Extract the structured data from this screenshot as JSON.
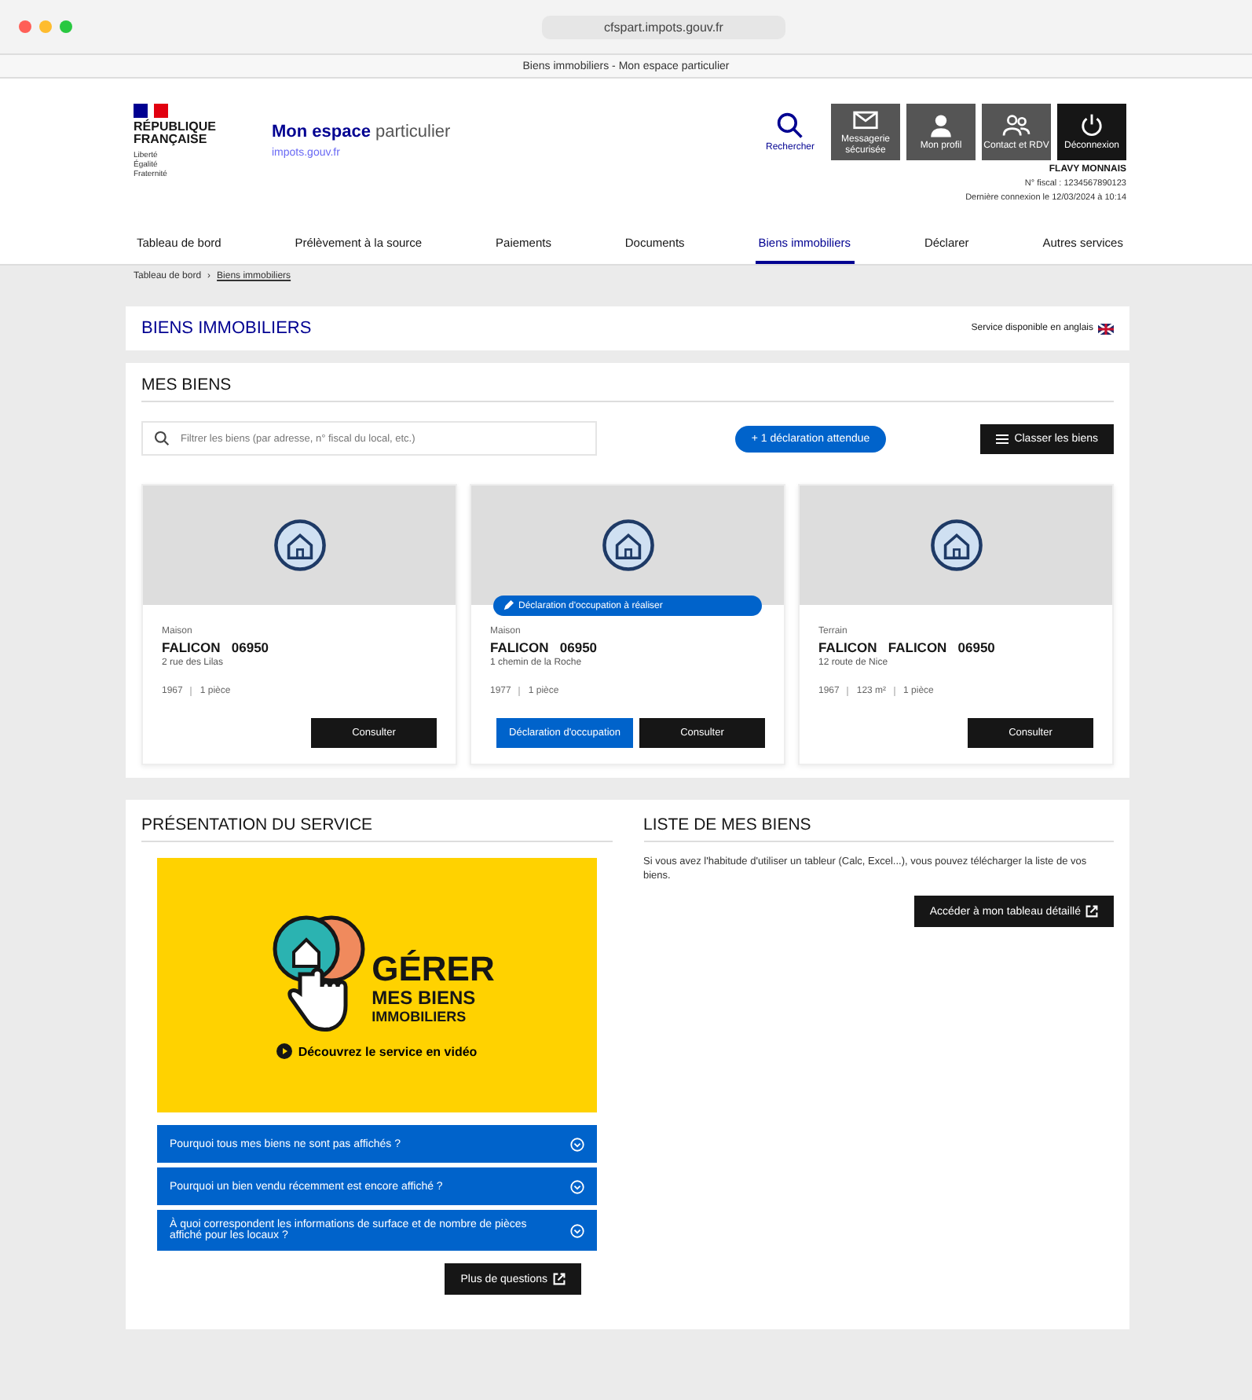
{
  "browser": {
    "url": "cfspart.impots.gouv.fr",
    "tab_title": "Biens immobiliers - Mon espace particulier"
  },
  "header": {
    "brand": "RÉPUBLIQUE FRANÇAISE",
    "motto": "Liberté Égalité Fraternité",
    "title_strong": "Mon espace",
    "title_light": "particulier",
    "subtitle": "impots.gouv.fr",
    "actions": [
      {
        "label": "Rechercher",
        "kind": "search"
      },
      {
        "label": "Messagerie sécurisée",
        "kind": "mail"
      },
      {
        "label": "Mon profil",
        "kind": "profile"
      },
      {
        "label": "Contact et RDV",
        "kind": "contact"
      },
      {
        "label": "Déconnexion",
        "kind": "power"
      }
    ],
    "user": {
      "name": "FLAVY MONNAIS",
      "fiscal_number": "N° fiscal : 1234567890123",
      "last_login": "Dernière connexion le 12/03/2024 à 10:14"
    }
  },
  "nav": [
    {
      "label": "Tableau de bord",
      "selected": false
    },
    {
      "label": "Prélèvement à la source",
      "selected": false
    },
    {
      "label": "Paiements",
      "selected": false
    },
    {
      "label": "Documents",
      "selected": false
    },
    {
      "label": "Biens immobiliers",
      "selected": true
    },
    {
      "label": "Déclarer",
      "selected": false
    },
    {
      "label": "Autres services",
      "selected": false
    }
  ],
  "breadcrumb": [
    "Tableau de bord",
    "Biens immobiliers"
  ],
  "breadcrumb_separator": "›",
  "page_title": "BIENS IMMOBILIERS",
  "language_note": "Service disponible en anglais",
  "properties": {
    "title": "MES BIENS",
    "search": {
      "placeholder": "Filtrer les biens (par adresse, n° fiscal du local, etc.)"
    },
    "pending_button": "+ 1 déclaration attendue",
    "sort_button": "Classer les biens",
    "cards": [
      {
        "type": "Maison",
        "city": "FALICON   06950",
        "address": "2 rue des Lilas",
        "details": [
          "1967",
          "1 pièce"
        ],
        "buttons": [
          {
            "label": "Consulter",
            "kind": "dark"
          }
        ]
      },
      {
        "type": "Maison",
        "city": "FALICON   06950",
        "address": "1 chemin de la Roche",
        "details": [
          "1977",
          "1 pièce"
        ],
        "badge": "Déclaration d'occupation à réaliser",
        "buttons": [
          {
            "label": "Déclaration d'occupation",
            "kind": "primary"
          },
          {
            "label": "Consulter",
            "kind": "dark"
          }
        ]
      },
      {
        "type": "Terrain",
        "city": "FALICON   FALICON   06950",
        "address": "12 route de Nice",
        "details": [
          "1967",
          "123 m²",
          "1 pièce"
        ],
        "buttons": [
          {
            "label": "Consulter",
            "kind": "dark"
          }
        ]
      }
    ]
  },
  "presentation": {
    "title": "PRÉSENTATION DU SERVICE",
    "banner_title": "GÉRER",
    "banner_subtitle": "MES BIENS",
    "banner_subtitle2": "IMMOBILIERS",
    "video_link": "Découvrez le service en vidéo",
    "faq": [
      {
        "question": "Pourquoi tous mes biens ne sont pas affichés ?",
        "expanded": false
      },
      {
        "question": "Pourquoi un bien vendu récemment est encore affiché ?",
        "expanded": false
      },
      {
        "question": "À quoi correspondent les informations de surface et de nombre de pièces affiché pour les locaux ?",
        "expanded": false
      }
    ],
    "more_button": "Plus de questions"
  },
  "list": {
    "title": "LISTE DE MES BIENS",
    "text": "Si vous avez l'habitude d'utiliser un tableur (Calc, Excel...), vous pouvez télécharger la liste de vos biens.",
    "button": "Accéder à mon tableau détaillé"
  }
}
